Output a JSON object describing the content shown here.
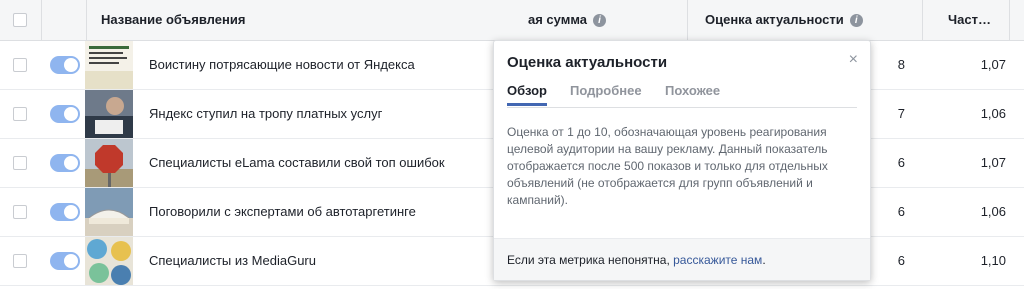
{
  "header": {
    "col_name": "Название объявления",
    "col_amount": "ая сумма",
    "col_relevance": "Оценка актуальности",
    "col_freq": "Част…",
    "info_glyph": "i"
  },
  "rows": [
    {
      "name": "Воистину потрясающие новости от Яндекса",
      "score": "8",
      "freq": "1,07"
    },
    {
      "name": "Яндекс ступил на тропу платных услуг",
      "score": "7",
      "freq": "1,06"
    },
    {
      "name": "Специалисты eLama составили свой топ ошибок",
      "score": "6",
      "freq": "1,07"
    },
    {
      "name": "Поговорили с экспертами об автотаргетинге",
      "score": "6",
      "freq": "1,06"
    },
    {
      "name": "Специалисты из MediaGuru",
      "score": "6",
      "freq": "1,10"
    }
  ],
  "popup": {
    "title": "Оценка актуальности",
    "close": "×",
    "tabs": [
      "Обзор",
      "Подробнее",
      "Похожее"
    ],
    "description": "Оценка от 1 до 10, обозначающая уровень реагирования целевой аудитории на вашу рекламу. Данный показатель отображается после 500 показов и только для отдельных объявлений (не отображается для групп объявлений и кампаний).",
    "footer_text": "Если эта метрика непонятна, ",
    "footer_link": "расскажите нам",
    "footer_end": "."
  },
  "colors": {
    "accent": "#4267b2",
    "toggle": "#8fb5ef",
    "link": "#365899"
  }
}
